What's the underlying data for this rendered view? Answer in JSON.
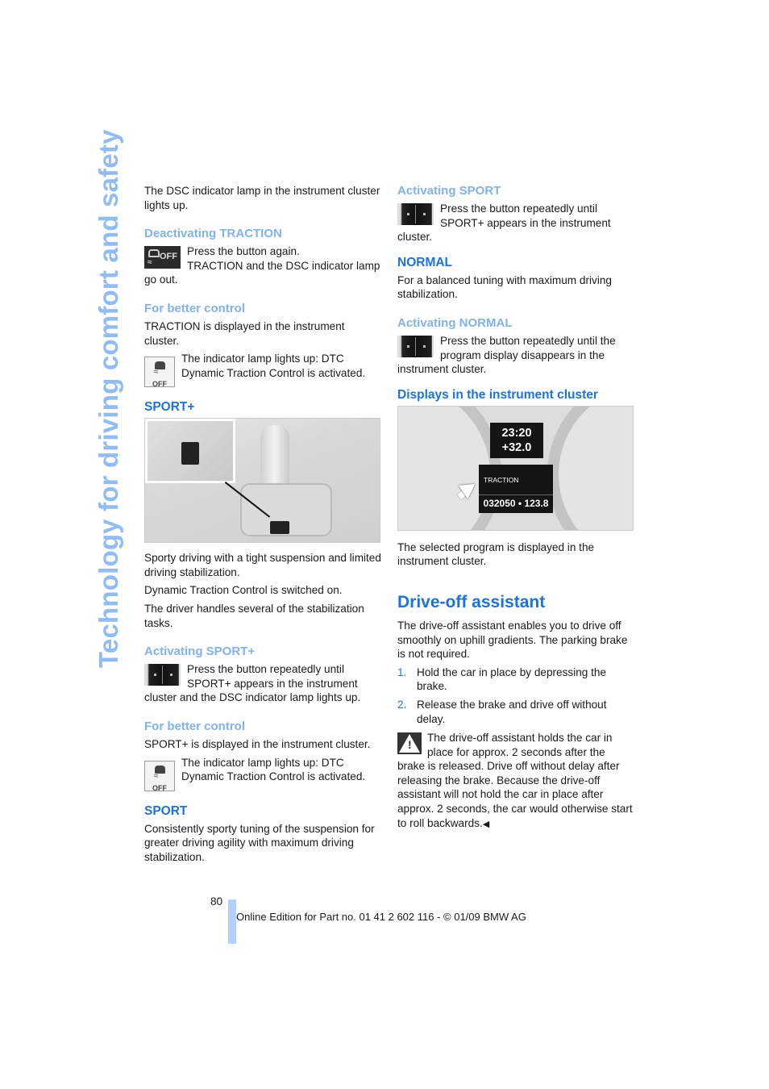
{
  "side_title": "Technology for driving comfort and safety",
  "left_column": {
    "intro": "The DSC indicator lamp in the instrument cluster lights up.",
    "deactivating_traction": {
      "heading": "Deactivating TRACTION",
      "icon": "dsc-off-button-icon",
      "text": "Press the button again. TRACTION and the DSC indicator lamp go out.",
      "line1": "Press the button again.",
      "line2": "TRACTION and the DSC indicator lamp go out."
    },
    "better_control_1": {
      "heading": "For better control",
      "text": "TRACTION is displayed in the instrument cluster.",
      "icon": "dtc-off-indicator-icon",
      "icon_label": "OFF",
      "icon_text": "The indicator lamp lights up: DTC Dynamic Traction Control is activated."
    },
    "sport_plus": {
      "heading": "SPORT+",
      "photo": "center-console-switch-photo",
      "p1": "Sporty driving with a tight suspension and limited driving stabilization.",
      "p2": "Dynamic Traction Control is switched on.",
      "p3": "The driver handles several of the stabilization tasks."
    },
    "activating_sport_plus": {
      "heading": "Activating SPORT+",
      "icon": "drive-mode-button-icon",
      "text": "Press the button repeatedly until SPORT+ appears in the instrument cluster and the DSC indicator lamp lights up."
    },
    "better_control_2": {
      "heading": "For better control",
      "text": "SPORT+ is displayed in the instrument cluster.",
      "icon": "dtc-off-indicator-icon",
      "icon_label": "OFF",
      "icon_text": "The indicator lamp lights up: DTC Dynamic Traction Control is activated."
    },
    "sport": {
      "heading": "SPORT",
      "text": "Consistently sporty tuning of the suspension for greater driving agility with maximum driving stabilization."
    }
  },
  "right_column": {
    "activating_sport": {
      "heading": "Activating SPORT",
      "icon": "drive-mode-button-icon",
      "text": "Press the button repeatedly until SPORT+ appears in the instrument cluster."
    },
    "normal": {
      "heading": "NORMAL",
      "text": "For a balanced tuning with maximum driving stabilization."
    },
    "activating_normal": {
      "heading": "Activating NORMAL",
      "icon": "drive-mode-button-icon",
      "text": "Press the button repeatedly until the program display disappears in the instrument cluster."
    },
    "displays": {
      "heading": "Displays in the instrument cluster",
      "cluster": {
        "time": "23:20",
        "temperature": "+32.0",
        "program": "TRACTION",
        "odometer": "032050 • 123.8"
      },
      "caption": "The selected program is displayed in the instrument cluster."
    },
    "drive_off": {
      "heading": "Drive-off assistant",
      "intro": "The drive-off assistant enables you to drive off smoothly on uphill gradients. The parking brake is not required.",
      "steps": [
        {
          "num": "1.",
          "text": "Hold the car in place by depressing the brake."
        },
        {
          "num": "2.",
          "text": "Release the brake and drive off without delay."
        }
      ],
      "warning_icon": "warning-triangle-icon",
      "warning": "The drive-off assistant holds the car in place for approx. 2 seconds after the brake is released. Drive off without delay after releasing the brake. Because the drive-off assistant will not hold the car in place after approx. 2 seconds, the car would otherwise start to roll backwards.",
      "end_mark": "◀"
    }
  },
  "footer": {
    "page_number": "80",
    "edition": "Online Edition for Part no. 01 41 2 602 116 - © 01/09 BMW AG"
  },
  "colors": {
    "heading_dark": "#1a73e6",
    "heading_light": "#7fb2f0",
    "side_title": "#8fbcf5",
    "footer_bar": "#b3d2fb"
  }
}
